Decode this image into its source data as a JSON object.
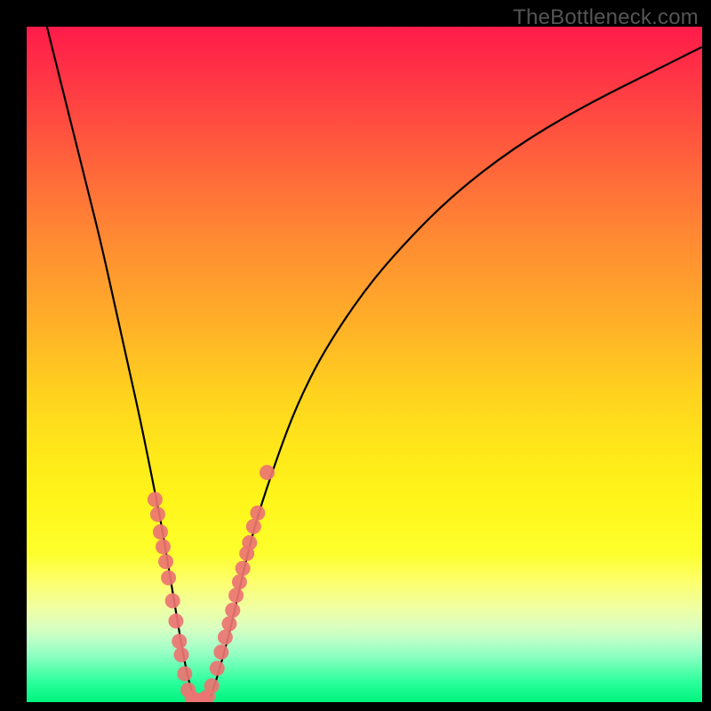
{
  "watermark": "TheBottleneck.com",
  "chart_data": {
    "type": "line",
    "title": "",
    "xlabel": "",
    "ylabel": "",
    "xlim": [
      0,
      100
    ],
    "ylim": [
      0,
      100
    ],
    "grid": false,
    "legend": false,
    "series": [
      {
        "name": "bottleneck-curve",
        "x": [
          3,
          5,
          7,
          9,
          11,
          13,
          15,
          17,
          19,
          20,
          21,
          22,
          23,
          24,
          25,
          26,
          27,
          28,
          30,
          32,
          34,
          37,
          40,
          44,
          50,
          56,
          63,
          72,
          82,
          94,
          100
        ],
        "y": [
          100,
          92,
          84,
          76,
          68,
          59,
          50,
          41,
          31,
          26,
          20,
          14,
          8,
          3,
          0,
          0,
          0,
          3,
          10,
          19,
          27,
          36,
          44,
          52,
          61,
          68,
          75,
          82,
          88,
          94,
          97
        ]
      }
    ],
    "scatter_points": {
      "name": "highlighted-samples",
      "color": "#ec7472",
      "x": [
        19.0,
        19.4,
        19.8,
        20.2,
        20.6,
        21.0,
        21.6,
        22.1,
        22.6,
        22.9,
        23.4,
        23.9,
        24.5,
        25.0,
        25.6,
        26.2,
        26.8,
        27.4,
        28.2,
        28.8,
        29.4,
        30.0,
        30.5,
        31.0,
        31.5,
        32.0,
        32.6,
        33.0,
        33.6,
        34.2,
        35.6
      ],
      "y": [
        30.0,
        27.8,
        25.2,
        23.0,
        20.8,
        18.4,
        15.0,
        12.0,
        9.0,
        7.0,
        4.2,
        1.8,
        0.6,
        0.2,
        0.2,
        0.4,
        0.8,
        2.4,
        5.0,
        7.4,
        9.6,
        11.6,
        13.6,
        15.8,
        17.8,
        19.8,
        22.0,
        23.6,
        26.0,
        28.0,
        34.0
      ]
    },
    "background_gradient": {
      "top": "#ff1b4a",
      "mid": "#ffe81a",
      "bottom": "#00f37e"
    }
  }
}
